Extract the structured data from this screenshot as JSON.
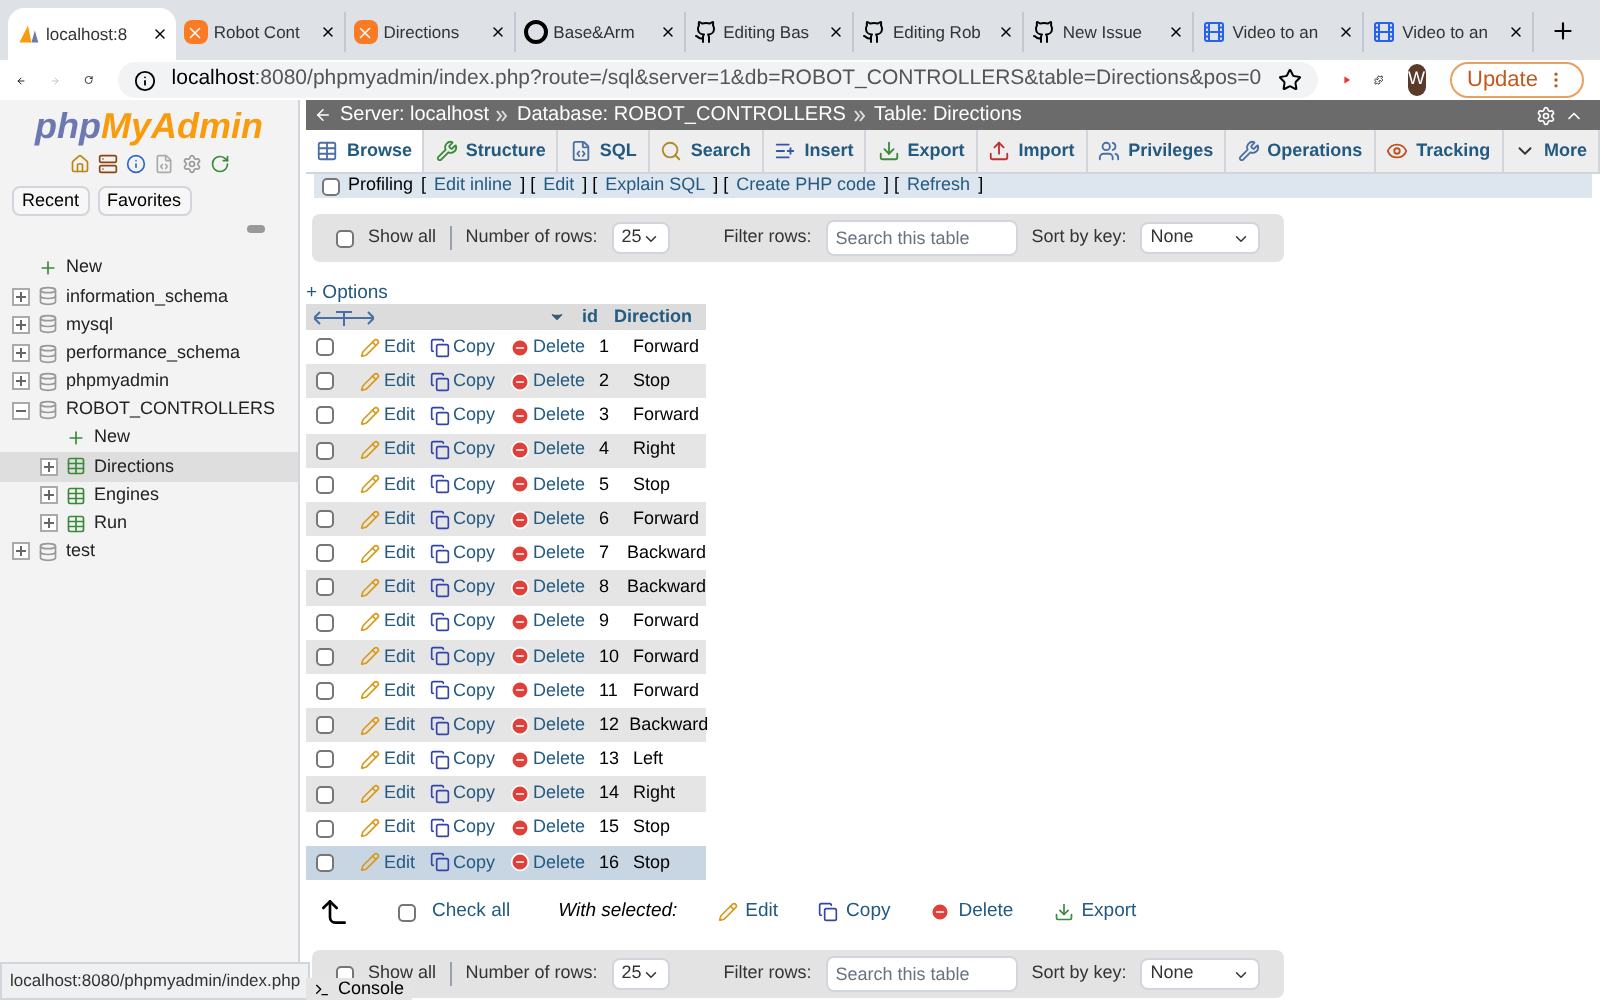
{
  "browser_tabs": [
    {
      "title": "localhost:8",
      "selected": true,
      "kind": "pma"
    },
    {
      "title": "Robot Cont",
      "selected": false,
      "kind": "xampp"
    },
    {
      "title": "Directions",
      "selected": false,
      "kind": "xampp"
    },
    {
      "title": "Base&Arm",
      "selected": false,
      "kind": "app"
    },
    {
      "title": "Editing Bas",
      "selected": false,
      "kind": "github"
    },
    {
      "title": "Editing Rob",
      "selected": false,
      "kind": "github"
    },
    {
      "title": "New Issue",
      "selected": false,
      "kind": "github"
    },
    {
      "title": "Video to an",
      "selected": false,
      "kind": "video"
    },
    {
      "title": "Video to an",
      "selected": false,
      "kind": "video"
    }
  ],
  "address_bar": {
    "host": "localhost",
    "rest": ":8080/phpmyadmin/index.php?route=/sql&server=1&db=ROBOT_CONTROLLERS&table=Directions&pos=0"
  },
  "profile_initial": "W",
  "update_button": "Update",
  "sidebar": {
    "logo_left": "php",
    "logo_right": "MyAdmin",
    "buttons": [
      "Recent",
      "Favorites"
    ],
    "tree": [
      {
        "label": "New",
        "kind": "new",
        "selected": false
      },
      {
        "label": "information_schema",
        "kind": "db",
        "expanded": false,
        "selected": false
      },
      {
        "label": "mysql",
        "kind": "db",
        "expanded": false,
        "selected": false
      },
      {
        "label": "performance_schema",
        "kind": "db",
        "expanded": false,
        "selected": false
      },
      {
        "label": "phpmyadmin",
        "kind": "db",
        "expanded": false,
        "selected": false
      },
      {
        "label": "ROBOT_CONTROLLERS",
        "kind": "db",
        "expanded": true,
        "selected": false,
        "children": [
          {
            "label": "New",
            "kind": "new",
            "selected": false
          },
          {
            "label": "Directions",
            "kind": "table",
            "expanded": false,
            "selected": true
          },
          {
            "label": "Engines",
            "kind": "table",
            "expanded": false,
            "selected": false
          },
          {
            "label": "Run",
            "kind": "table",
            "expanded": false,
            "selected": false
          }
        ]
      },
      {
        "label": "test",
        "kind": "db",
        "expanded": false,
        "selected": false
      }
    ]
  },
  "breadcrumb": [
    "Server: localhost",
    "Database: ROBOT_CONTROLLERS",
    "Table: Directions"
  ],
  "menu_tabs": [
    {
      "label": "Browse",
      "kind": "browse",
      "selected": true
    },
    {
      "label": "Structure",
      "kind": "structure",
      "selected": false
    },
    {
      "label": "SQL",
      "kind": "sql",
      "selected": false
    },
    {
      "label": "Search",
      "kind": "search",
      "selected": false
    },
    {
      "label": "Insert",
      "kind": "insert",
      "selected": false
    },
    {
      "label": "Export",
      "kind": "export",
      "selected": false
    },
    {
      "label": "Import",
      "kind": "import",
      "selected": false
    },
    {
      "label": "Privileges",
      "kind": "privileges",
      "selected": false
    },
    {
      "label": "Operations",
      "kind": "operations",
      "selected": false
    },
    {
      "label": "Tracking",
      "kind": "tracking",
      "selected": false
    },
    {
      "label": "More",
      "kind": "more",
      "selected": false
    }
  ],
  "profiling": {
    "label": "Profiling",
    "checked": false,
    "items": [
      {
        "text": "[",
        "kind": "bracket"
      },
      {
        "text": "Edit inline",
        "kind": "link"
      },
      {
        "text": "] [",
        "kind": "bracket"
      },
      {
        "text": "Edit",
        "kind": "link"
      },
      {
        "text": "] [",
        "kind": "bracket"
      },
      {
        "text": "Explain SQL",
        "kind": "link"
      },
      {
        "text": "] [",
        "kind": "bracket"
      },
      {
        "text": "Create PHP code",
        "kind": "link"
      },
      {
        "text": "] [",
        "kind": "bracket"
      },
      {
        "text": "Refresh",
        "kind": "link"
      },
      {
        "text": "]",
        "kind": "bracket"
      }
    ]
  },
  "nav_bar": {
    "show_all": "Show all",
    "show_all_checked": false,
    "rows_label": "Number of rows:",
    "rows_value": "25",
    "filter_label": "Filter rows:",
    "filter_placeholder": "Search this table",
    "sort_label": "Sort by key:",
    "sort_value": "None"
  },
  "options_link": "+ Options",
  "table": {
    "columns": [
      "id",
      "Direction"
    ],
    "rows": [
      {
        "actions": [
          "Edit",
          "Copy",
          "Delete"
        ],
        "id": "1",
        "direction": "Forward",
        "checked": false,
        "highlighted": false
      },
      {
        "actions": [
          "Edit",
          "Copy",
          "Delete"
        ],
        "id": "2",
        "direction": "Stop",
        "checked": false,
        "highlighted": false
      },
      {
        "actions": [
          "Edit",
          "Copy",
          "Delete"
        ],
        "id": "3",
        "direction": "Forward",
        "checked": false,
        "highlighted": false
      },
      {
        "actions": [
          "Edit",
          "Copy",
          "Delete"
        ],
        "id": "4",
        "direction": "Right",
        "checked": false,
        "highlighted": false
      },
      {
        "actions": [
          "Edit",
          "Copy",
          "Delete"
        ],
        "id": "5",
        "direction": "Stop",
        "checked": false,
        "highlighted": false
      },
      {
        "actions": [
          "Edit",
          "Copy",
          "Delete"
        ],
        "id": "6",
        "direction": "Forward",
        "checked": false,
        "highlighted": false
      },
      {
        "actions": [
          "Edit",
          "Copy",
          "Delete"
        ],
        "id": "7",
        "direction": "Backward",
        "checked": false,
        "highlighted": false
      },
      {
        "actions": [
          "Edit",
          "Copy",
          "Delete"
        ],
        "id": "8",
        "direction": "Backward",
        "checked": false,
        "highlighted": false
      },
      {
        "actions": [
          "Edit",
          "Copy",
          "Delete"
        ],
        "id": "9",
        "direction": "Forward",
        "checked": false,
        "highlighted": false
      },
      {
        "actions": [
          "Edit",
          "Copy",
          "Delete"
        ],
        "id": "10",
        "direction": "Forward",
        "checked": false,
        "highlighted": false
      },
      {
        "actions": [
          "Edit",
          "Copy",
          "Delete"
        ],
        "id": "11",
        "direction": "Forward",
        "checked": false,
        "highlighted": false
      },
      {
        "actions": [
          "Edit",
          "Copy",
          "Delete"
        ],
        "id": "12",
        "direction": "Backward",
        "checked": false,
        "highlighted": false
      },
      {
        "actions": [
          "Edit",
          "Copy",
          "Delete"
        ],
        "id": "13",
        "direction": "Left",
        "checked": false,
        "highlighted": false
      },
      {
        "actions": [
          "Edit",
          "Copy",
          "Delete"
        ],
        "id": "14",
        "direction": "Right",
        "checked": false,
        "highlighted": false
      },
      {
        "actions": [
          "Edit",
          "Copy",
          "Delete"
        ],
        "id": "15",
        "direction": "Stop",
        "checked": false,
        "highlighted": false
      },
      {
        "actions": [
          "Edit",
          "Copy",
          "Delete"
        ],
        "id": "16",
        "direction": "Stop",
        "checked": false,
        "highlighted": true
      }
    ]
  },
  "bulk": {
    "check_all": "Check all",
    "check_all_checked": false,
    "with_selected": "With selected:",
    "actions": [
      {
        "label": "Edit",
        "kind": "edit"
      },
      {
        "label": "Copy",
        "kind": "copy"
      },
      {
        "label": "Delete",
        "kind": "delete"
      },
      {
        "label": "Export",
        "kind": "export"
      }
    ]
  },
  "bottom_nav_bar": {
    "show_all": "Show all",
    "show_all_checked": false,
    "rows_label": "Number of rows:",
    "rows_value": "25",
    "filter_label": "Filter rows:",
    "filter_placeholder": "Search this table",
    "sort_label": "Sort by key:",
    "sort_value": "None"
  },
  "console": "Console",
  "status_url": "localhost:8080/phpmyadmin/index.php"
}
